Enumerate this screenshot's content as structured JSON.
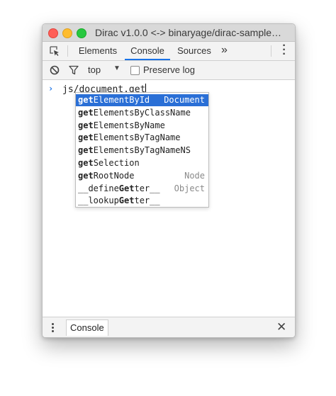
{
  "window": {
    "title": "Dirac v1.0.0 <-> binaryage/dirac-sample…"
  },
  "tabs": [
    {
      "label": "Elements",
      "active": false
    },
    {
      "label": "Console",
      "active": true
    },
    {
      "label": "Sources",
      "active": false
    }
  ],
  "tab_overflow": "»",
  "toolbar": {
    "context": "top",
    "preserve_log_label": "Preserve log",
    "preserve_log_checked": false
  },
  "console": {
    "prompt": "›",
    "input": "js/document.get"
  },
  "suggestions": [
    {
      "match": "get",
      "rest": "ElementById",
      "type": "Document",
      "selected": true
    },
    {
      "match": "get",
      "rest": "ElementsByClassName",
      "type": "",
      "selected": false
    },
    {
      "match": "get",
      "rest": "ElementsByName",
      "type": "",
      "selected": false
    },
    {
      "match": "get",
      "rest": "ElementsByTagName",
      "type": "",
      "selected": false
    },
    {
      "match": "get",
      "rest": "ElementsByTagNameNS",
      "type": "",
      "selected": false
    },
    {
      "match": "get",
      "rest": "Selection",
      "type": "",
      "selected": false
    },
    {
      "match": "get",
      "rest": "RootNode",
      "type": "Node",
      "selected": false
    },
    {
      "pre": "__define",
      "match": "Get",
      "rest": "ter__",
      "type": "Object",
      "selected": false
    },
    {
      "pre": "__lookup",
      "match": "Get",
      "rest": "ter__",
      "type": "",
      "selected": false
    }
  ],
  "drawer": {
    "tab_label": "Console",
    "close_symbol": "✕"
  },
  "colors": {
    "accent": "#1a73e8",
    "selection": "#2a6fd6"
  }
}
